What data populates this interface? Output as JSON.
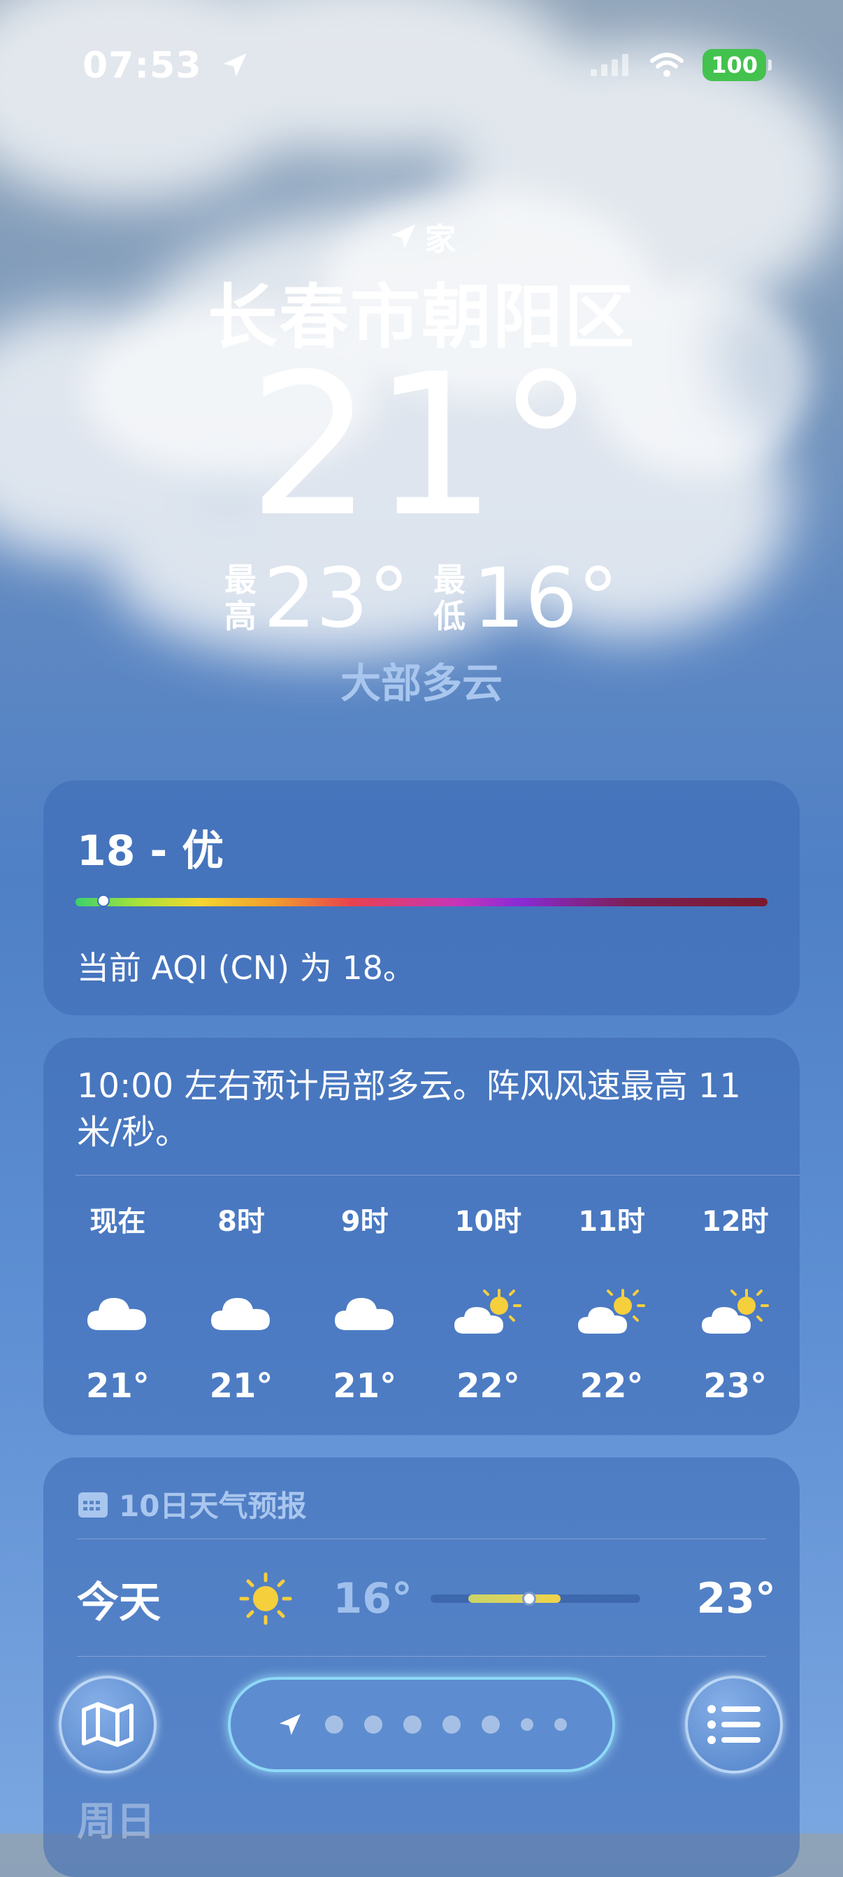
{
  "status_bar": {
    "time": "07:53",
    "battery": "100"
  },
  "header": {
    "location_tag": "家",
    "city": "长春市朝阳区",
    "temperature": "21°",
    "high_label_1": "最",
    "high_label_2": "高",
    "high_value": "23°",
    "low_label_1": "最",
    "low_label_2": "低",
    "low_value": "16°",
    "condition": "大部多云"
  },
  "aqi": {
    "value": "18 - 优",
    "level_fraction": 0.04,
    "description": "当前 AQI (CN) 为 18。"
  },
  "hourly": {
    "summary": "10:00 左右预计局部多云。阵风风速最高 11 米/秒。",
    "hours": [
      {
        "label": "现在",
        "icon": "cloud-icon",
        "temp": "21°"
      },
      {
        "label": "8时",
        "icon": "cloud-icon",
        "temp": "21°"
      },
      {
        "label": "9时",
        "icon": "cloud-icon",
        "temp": "21°"
      },
      {
        "label": "10时",
        "icon": "partly-sunny-icon",
        "temp": "22°"
      },
      {
        "label": "11时",
        "icon": "partly-sunny-icon",
        "temp": "22°"
      },
      {
        "label": "12时",
        "icon": "partly-sunny-icon",
        "temp": "23°"
      }
    ]
  },
  "forecast": {
    "title": "10日天气预报",
    "days": [
      {
        "name": "今天",
        "icon": "sun-icon",
        "low": "16°",
        "high": "23°",
        "range_start": 0.18,
        "range_end": 0.62,
        "current": 0.47
      }
    ],
    "partial_row": "周日"
  },
  "bottom_bar": {
    "page_count": 7
  },
  "colors": {
    "sun": "#f6cf3d",
    "battery": "#44c24e",
    "accent_text": "#a9c6ee"
  }
}
